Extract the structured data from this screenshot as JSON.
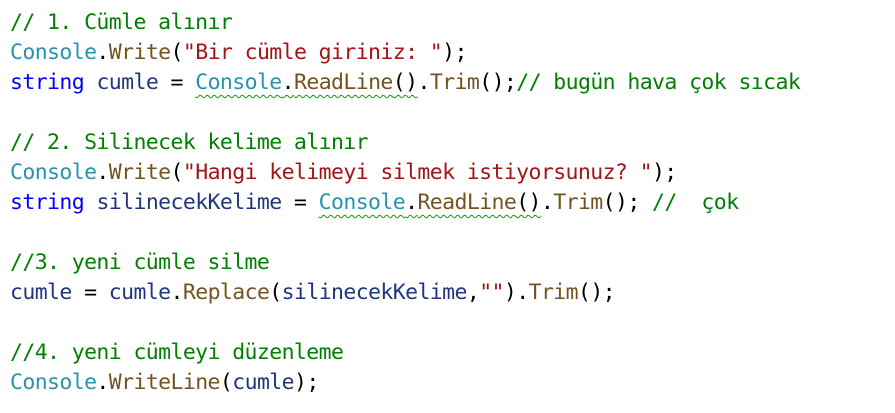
{
  "editor": {
    "colors": {
      "comment": "#008000",
      "keyword": "#0000ff",
      "type": "#2b91af",
      "method": "#74531f",
      "string": "#a31515",
      "variable": "#1f377f",
      "warning_squiggle": "#0a9a0a"
    },
    "lines": [
      {
        "tokens": [
          {
            "kind": "comment",
            "text": "// 1. Cümle alınır"
          }
        ]
      },
      {
        "tokens": [
          {
            "kind": "type",
            "text": "Console"
          },
          {
            "kind": "punct",
            "text": "."
          },
          {
            "kind": "method",
            "text": "Write"
          },
          {
            "kind": "punct",
            "text": "("
          },
          {
            "kind": "string",
            "text": "\"Bir cümle giriniz: \""
          },
          {
            "kind": "punct",
            "text": ");"
          }
        ]
      },
      {
        "tokens": [
          {
            "kind": "keyword",
            "text": "string"
          },
          {
            "kind": "punct",
            "text": " "
          },
          {
            "kind": "variable",
            "text": "cumle"
          },
          {
            "kind": "punct",
            "text": " = "
          },
          {
            "kind": "type",
            "text": "Console",
            "squiggle": true
          },
          {
            "kind": "punct",
            "text": ".",
            "squiggle": true
          },
          {
            "kind": "method",
            "text": "ReadLine",
            "squiggle": true
          },
          {
            "kind": "punct",
            "text": "()",
            "squiggle": true
          },
          {
            "kind": "punct",
            "text": "."
          },
          {
            "kind": "method",
            "text": "Trim"
          },
          {
            "kind": "punct",
            "text": "();"
          },
          {
            "kind": "comment",
            "text": "// bugün hava çok sıcak"
          }
        ]
      },
      {
        "tokens": []
      },
      {
        "tokens": [
          {
            "kind": "comment",
            "text": "// 2. Silinecek kelime alınır"
          }
        ]
      },
      {
        "tokens": [
          {
            "kind": "type",
            "text": "Console"
          },
          {
            "kind": "punct",
            "text": "."
          },
          {
            "kind": "method",
            "text": "Write"
          },
          {
            "kind": "punct",
            "text": "("
          },
          {
            "kind": "string",
            "text": "\"Hangi kelimeyi silmek istiyorsunuz? \""
          },
          {
            "kind": "punct",
            "text": ");"
          }
        ]
      },
      {
        "tokens": [
          {
            "kind": "keyword",
            "text": "string"
          },
          {
            "kind": "punct",
            "text": " "
          },
          {
            "kind": "variable",
            "text": "silinecekKelime"
          },
          {
            "kind": "punct",
            "text": " = "
          },
          {
            "kind": "type",
            "text": "Console",
            "squiggle": true
          },
          {
            "kind": "punct",
            "text": ".",
            "squiggle": true
          },
          {
            "kind": "method",
            "text": "ReadLine",
            "squiggle": true
          },
          {
            "kind": "punct",
            "text": "()",
            "squiggle": true
          },
          {
            "kind": "punct",
            "text": "."
          },
          {
            "kind": "method",
            "text": "Trim"
          },
          {
            "kind": "punct",
            "text": "(); "
          },
          {
            "kind": "comment",
            "text": "//  çok"
          }
        ]
      },
      {
        "tokens": []
      },
      {
        "tokens": [
          {
            "kind": "comment",
            "text": "//3. yeni cümle silme"
          }
        ]
      },
      {
        "tokens": [
          {
            "kind": "variable",
            "text": "cumle"
          },
          {
            "kind": "punct",
            "text": " = "
          },
          {
            "kind": "variable",
            "text": "cumle"
          },
          {
            "kind": "punct",
            "text": "."
          },
          {
            "kind": "method",
            "text": "Replace"
          },
          {
            "kind": "punct",
            "text": "("
          },
          {
            "kind": "variable",
            "text": "silinecekKelime"
          },
          {
            "kind": "punct",
            "text": ","
          },
          {
            "kind": "string",
            "text": "\"\""
          },
          {
            "kind": "punct",
            "text": ")."
          },
          {
            "kind": "method",
            "text": "Trim"
          },
          {
            "kind": "punct",
            "text": "();"
          }
        ]
      },
      {
        "tokens": []
      },
      {
        "tokens": [
          {
            "kind": "comment",
            "text": "//4. yeni cümleyi düzenleme"
          }
        ]
      },
      {
        "tokens": [
          {
            "kind": "type",
            "text": "Console"
          },
          {
            "kind": "punct",
            "text": "."
          },
          {
            "kind": "method",
            "text": "WriteLine"
          },
          {
            "kind": "punct",
            "text": "("
          },
          {
            "kind": "variable",
            "text": "cumle"
          },
          {
            "kind": "punct",
            "text": ");"
          }
        ]
      }
    ]
  }
}
